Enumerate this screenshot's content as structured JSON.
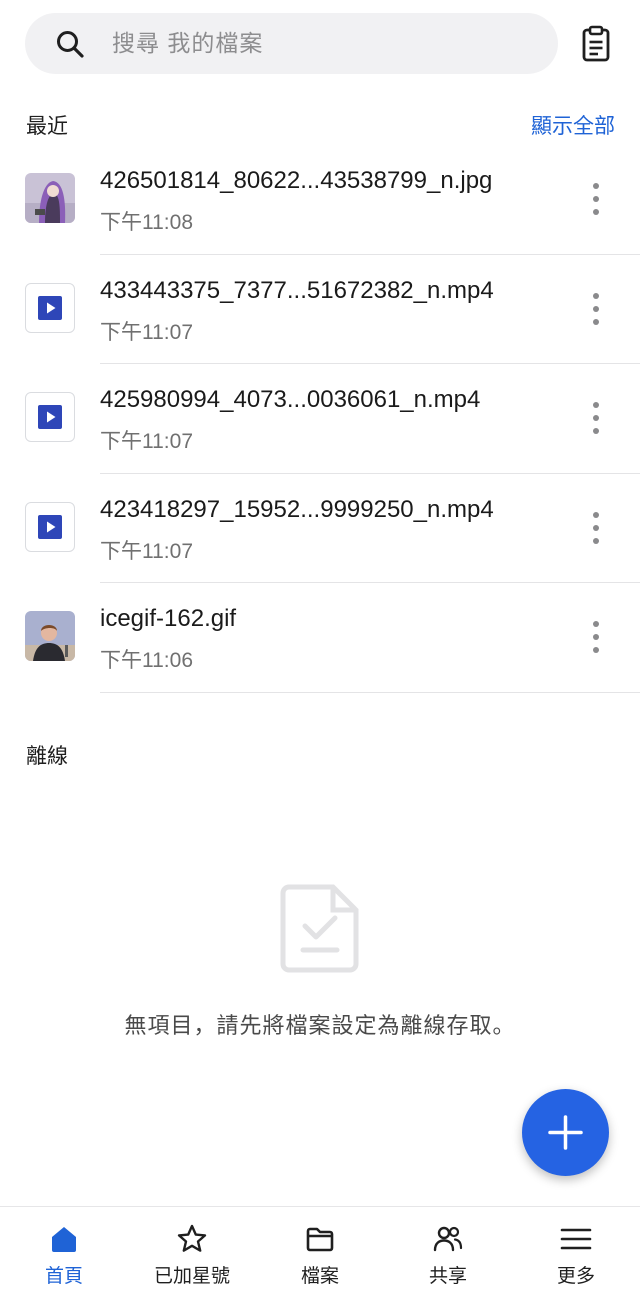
{
  "search": {
    "placeholder": "搜尋 我的檔案"
  },
  "recent": {
    "title": "最近",
    "show_all_label": "顯示全部",
    "files": [
      {
        "name": "426501814_80622...43538799_n.jpg",
        "time": "下午11:08",
        "type": "image"
      },
      {
        "name": "433443375_7377...51672382_n.mp4",
        "time": "下午11:07",
        "type": "video"
      },
      {
        "name": "425980994_4073...0036061_n.mp4",
        "time": "下午11:07",
        "type": "video"
      },
      {
        "name": "423418297_15952...9999250_n.mp4",
        "time": "下午11:07",
        "type": "video"
      },
      {
        "name": "icegif-162.gif",
        "time": "下午11:06",
        "type": "gif"
      }
    ]
  },
  "offline": {
    "title": "離線",
    "empty_message": "無項目，請先將檔案設定為離線存取。"
  },
  "bottom_nav": {
    "items": [
      {
        "label": "首頁",
        "icon": "home-icon",
        "active": true
      },
      {
        "label": "已加星號",
        "icon": "star-icon",
        "active": false
      },
      {
        "label": "檔案",
        "icon": "folder-icon",
        "active": false
      },
      {
        "label": "共享",
        "icon": "people-icon",
        "active": false
      },
      {
        "label": "更多",
        "icon": "menu-icon",
        "active": false
      }
    ]
  },
  "colors": {
    "accent": "#1f63d6",
    "fab": "#2563e3",
    "video_icon": "#2e46b8",
    "search_bg": "#f1f1f3",
    "secondary_text": "#707070"
  }
}
